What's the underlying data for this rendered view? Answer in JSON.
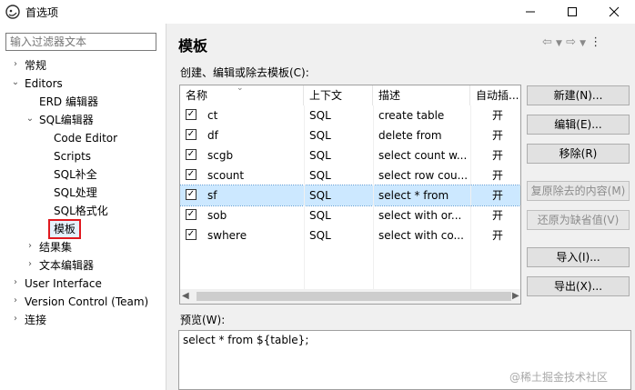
{
  "window": {
    "title": "首选项"
  },
  "filter": {
    "placeholder": "输入过滤器文本"
  },
  "tree": [
    {
      "label": "常规",
      "expander": "›"
    },
    {
      "label": "Editors",
      "expander": "⌄"
    },
    {
      "label": "ERD 编辑器",
      "expander": ""
    },
    {
      "label": "SQL编辑器",
      "expander": "⌄"
    },
    {
      "label": "Code Editor",
      "expander": ""
    },
    {
      "label": "Scripts",
      "expander": ""
    },
    {
      "label": "SQL补全",
      "expander": ""
    },
    {
      "label": "SQL处理",
      "expander": ""
    },
    {
      "label": "SQL格式化",
      "expander": ""
    },
    {
      "label": "模板",
      "expander": ""
    },
    {
      "label": "结果集",
      "expander": "›"
    },
    {
      "label": "文本编辑器",
      "expander": "›"
    },
    {
      "label": "User Interface",
      "expander": "›"
    },
    {
      "label": "Version Control (Team)",
      "expander": "›"
    },
    {
      "label": "连接",
      "expander": "›"
    }
  ],
  "page": {
    "title": "模板",
    "table_label": "创建、编辑或除去模板(C):",
    "preview_label": "预览(W):",
    "preview_text": "select * from ${table};"
  },
  "table": {
    "columns": [
      "名称",
      "上下文",
      "描述",
      "自动插..."
    ],
    "rows": [
      {
        "name": "ct",
        "context": "SQL",
        "desc": "create table",
        "auto": "开",
        "checked": true
      },
      {
        "name": "df",
        "context": "SQL",
        "desc": "delete from",
        "auto": "开",
        "checked": true
      },
      {
        "name": "scgb",
        "context": "SQL",
        "desc": "select count w...",
        "auto": "开",
        "checked": true
      },
      {
        "name": "scount",
        "context": "SQL",
        "desc": "select row cou...",
        "auto": "开",
        "checked": true
      },
      {
        "name": "sf",
        "context": "SQL",
        "desc": "select * from",
        "auto": "开",
        "checked": true
      },
      {
        "name": "sob",
        "context": "SQL",
        "desc": "select with or...",
        "auto": "开",
        "checked": true
      },
      {
        "name": "swhere",
        "context": "SQL",
        "desc": "select with co...",
        "auto": "开",
        "checked": true
      }
    ],
    "selected_row": 4
  },
  "buttons": {
    "new": "新建(N)...",
    "edit": "编辑(E)...",
    "remove": "移除(R)",
    "restore_removed": "复原除去的内容(M)",
    "revert_default": "还原为缺省值(V)",
    "import": "导入(I)...",
    "export": "导出(X)..."
  },
  "watermark": "@稀土掘金技术社区"
}
